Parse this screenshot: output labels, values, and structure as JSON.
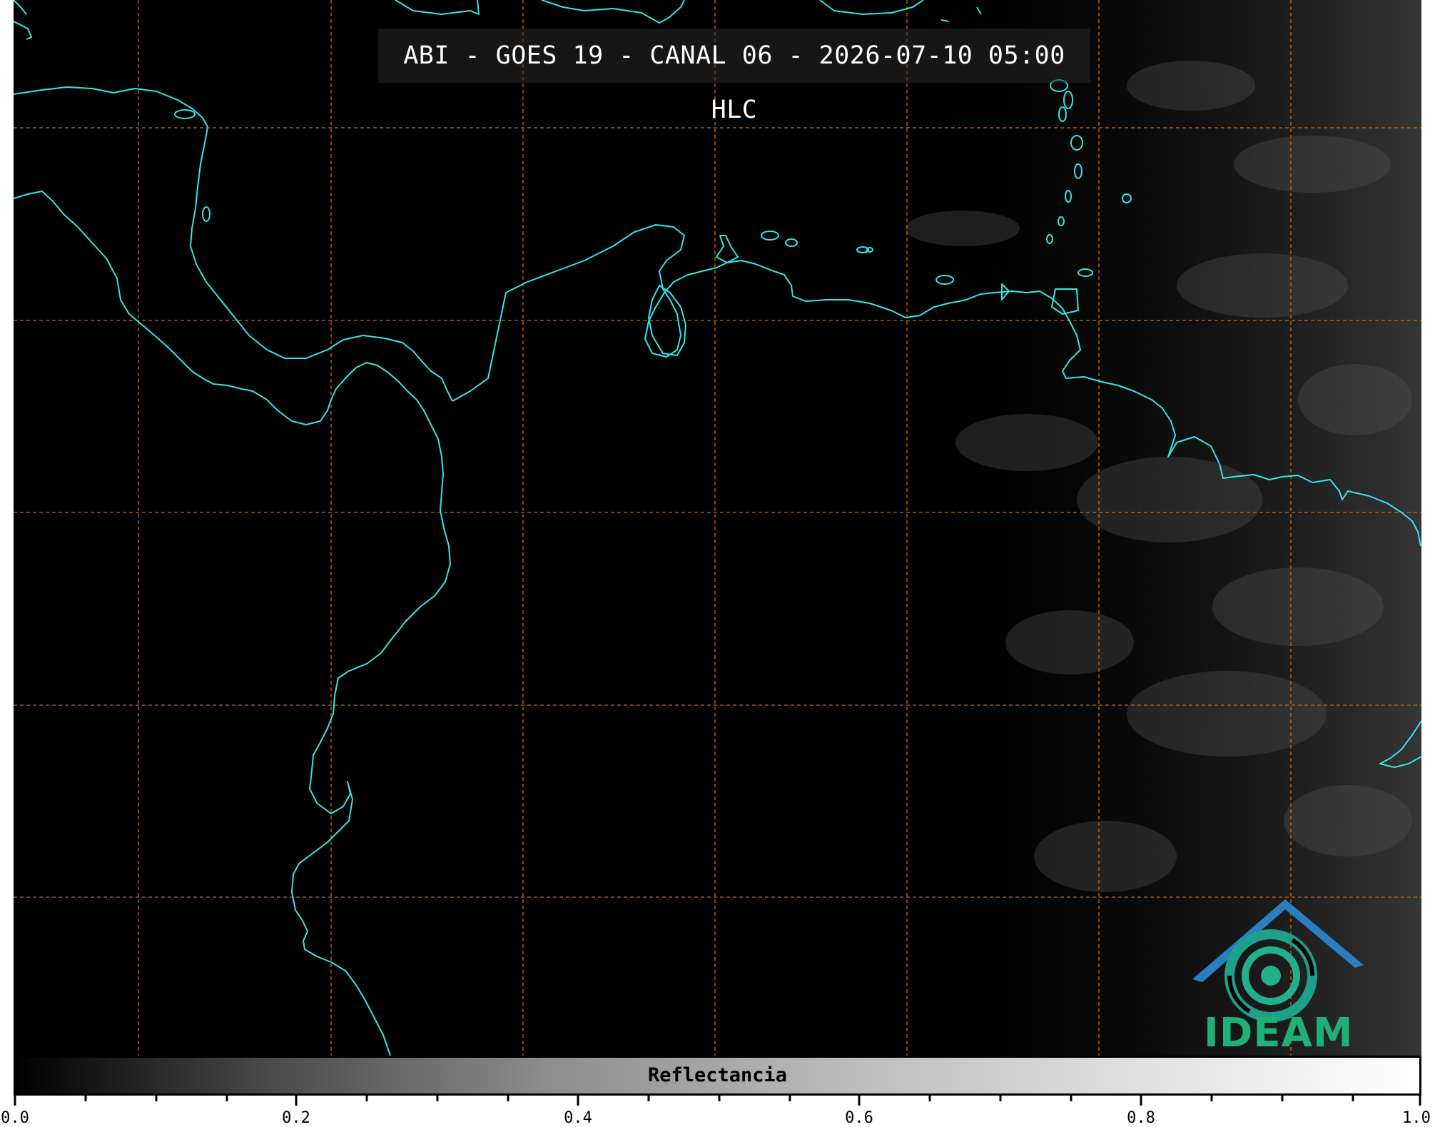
{
  "title": "ABI - GOES 19 - CANAL 06 - 2026-07-10 05:00 HLC",
  "colorbar": {
    "label": "Reflectancia",
    "tick_labels": [
      "0.0",
      "0.2",
      "0.4",
      "0.6",
      "0.8",
      "1.0"
    ],
    "range": [
      0.0,
      1.0
    ]
  },
  "logo": {
    "text": "IDEAM"
  },
  "colors": {
    "coastline": "#33e6e6",
    "grid": "#c86a20",
    "background": "#000000",
    "logo_blue": "#2a7fc0",
    "logo_green": "#1fb07a"
  },
  "icons": [
    "ideam-logo-icon"
  ]
}
